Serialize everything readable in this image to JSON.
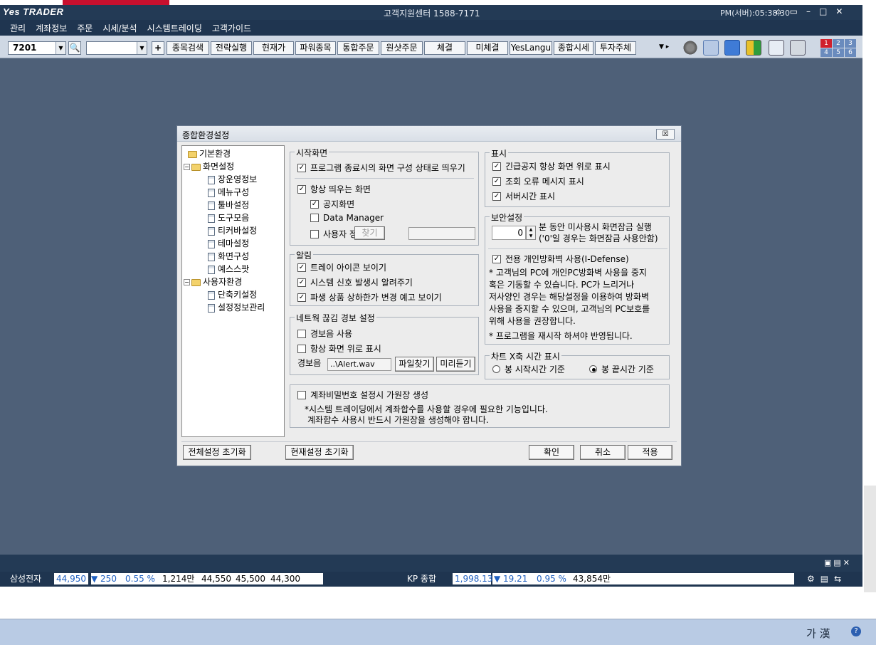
{
  "title_bar": {
    "logo": "Yes TRADER",
    "center_title": "고객지원센터 1588-7171",
    "clock": "PM(서버):05:38:30"
  },
  "menu": [
    "관리",
    "계좌정보",
    "주문",
    "시세/분석",
    "시스템트레이딩",
    "고객가이드"
  ],
  "toolbar": {
    "code_value": "7201",
    "buttons": [
      "종목검색",
      "전략실행",
      "현재가",
      "파워종목",
      "통합주문",
      "원샷주문",
      "체결",
      "미체결",
      "YesLangu",
      "종합시세",
      "투자주체"
    ],
    "screen_nums": [
      "1",
      "2",
      "3",
      "4",
      "5",
      "6"
    ]
  },
  "dialog": {
    "title": "종합환경설정",
    "close_label": "☒",
    "tree": [
      {
        "label": "기본환경",
        "type": "folder",
        "level": 0
      },
      {
        "label": "화면설정",
        "type": "folder",
        "level": 0,
        "expanded": true
      },
      {
        "label": "장운영정보",
        "type": "doc",
        "level": 1
      },
      {
        "label": "메뉴구성",
        "type": "doc",
        "level": 1
      },
      {
        "label": "툴바설정",
        "type": "doc",
        "level": 1
      },
      {
        "label": "도구모음",
        "type": "doc",
        "level": 1
      },
      {
        "label": "티커바설정",
        "type": "doc",
        "level": 1
      },
      {
        "label": "테마설정",
        "type": "doc",
        "level": 1
      },
      {
        "label": "화면구성",
        "type": "doc",
        "level": 1
      },
      {
        "label": "예스스팟",
        "type": "doc",
        "level": 1
      },
      {
        "label": "사용자환경",
        "type": "folder",
        "level": 0,
        "expanded": true
      },
      {
        "label": "단축키설정",
        "type": "doc",
        "level": 1
      },
      {
        "label": "설정정보관리",
        "type": "doc",
        "level": 1
      }
    ],
    "start_screen": {
      "label": "시작화면",
      "restore_layout": {
        "label": "프로그램 종료시의 화면 구성 상태로 띄우기",
        "checked": true
      },
      "always_screen": {
        "label": "항상 띄우는 화면",
        "checked": true
      },
      "notice_screen": {
        "label": "공지화면",
        "checked": true
      },
      "data_manager": {
        "label": "Data Manager",
        "checked": false
      },
      "user_defined": {
        "label": "사용자 정의",
        "checked": false
      },
      "find_button": "찾기"
    },
    "alarm": {
      "label": "알림",
      "tray_icon": {
        "label": "트레이 아이콘 보이기",
        "checked": true
      },
      "system_signal": {
        "label": "시스템 신호 발생시 알려주기",
        "checked": true
      },
      "derivative_limit": {
        "label": "파생 상품 상하한가 변경 예고 보이기",
        "checked": true
      }
    },
    "network": {
      "label": "네트웍 끊김 경보 설정",
      "use_alarm": {
        "label": "경보음 사용",
        "checked": false
      },
      "always_on_top": {
        "label": "항상 화면 위로 표시",
        "checked": false
      },
      "sound_label": "경보음",
      "sound_file": "..\\Alert.wav",
      "find_file_button": "파일찾기",
      "preview_button": "미리듣기"
    },
    "display": {
      "label": "표시",
      "urgent_notice": {
        "label": "긴급공지 항상 화면 위로 표시",
        "checked": true
      },
      "query_error": {
        "label": "조회 오류 메시지 표시",
        "checked": true
      },
      "server_time": {
        "label": "서버시간 표시",
        "checked": true
      }
    },
    "security": {
      "label": "보안설정",
      "lock_minutes": "0",
      "lock_text1": "분 동안 미사용시 화면잠금 실행",
      "lock_text2": "('0'일 경우는 화면잠금 사용안함)",
      "firewall": {
        "label": "전용 개인방화벽 사용(I-Defense)",
        "checked": true
      },
      "note_lines": [
        "* 고객님의 PC에 개인PC방화벽 사용을 중지",
        "혹은 기동할 수 있습니다. PC가 느리거나",
        "저사양인 경우는 해당설정을 이용하여 방화벽",
        "사용을 중지할 수 있으며, 고객님의 PC보호를",
        "위해 사용을 권장합니다."
      ],
      "restart_note": "* 프로그램을 재시작 하셔야 반영됩니다."
    },
    "chart_axis": {
      "label": "차트 X축 시간 표시",
      "start_time": {
        "label": "봉 시작시간 기준",
        "selected": false
      },
      "end_time": {
        "label": "봉 끝시간 기준",
        "selected": true
      }
    },
    "account_pw": {
      "checkbox": {
        "label": "계좌비밀번호 설정시 가원장 생성",
        "checked": false
      },
      "note1": "*시스템 트레이딩에서 계좌합수를 사용할 경우에 필요한 기능입니다.",
      "note2": "계좌합수 사용시 반드시 가원장을 생성해야 합니다."
    },
    "buttons": {
      "reset_all": "전체설정 초기화",
      "reset_current": "현재설정 초기화",
      "ok": "확인",
      "cancel": "취소",
      "apply": "적용"
    }
  },
  "ticker": {
    "stock_name": "삼성전자",
    "price": "44,950",
    "change": "▼ 250",
    "rate": "0.55 %",
    "volume": "1,214만",
    "open": "44,550",
    "high": "45,500",
    "low": "44,300",
    "index_name": "KP 종합",
    "index_value": "1,998.13",
    "index_change": "▼ 19.21",
    "index_rate": "0.95 %",
    "index_amount": "43,854만"
  },
  "taskbar": {
    "ime": "가 漢"
  },
  "colors": {
    "workspace": "#4e6078",
    "titlebar": "#233a55",
    "accent_blue": "#2060c0"
  }
}
